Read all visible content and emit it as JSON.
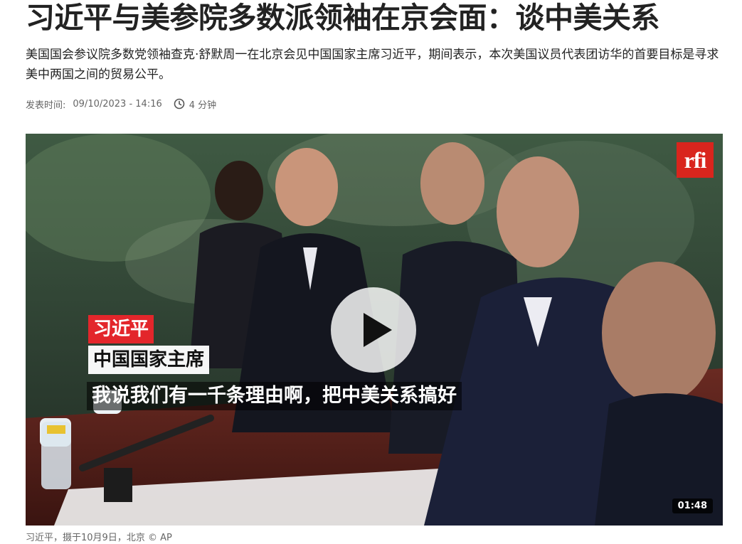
{
  "article": {
    "headline": "习近平与美参院多数派领袖在京会面：谈中美关系",
    "lede": "美国国会参议院多数党领袖查克·舒默周一在北京会见中国国家主席习近平，期间表示，本次美国议员代表团访华的首要目标是寻求美中两国之间的贸易公平。",
    "meta": {
      "published_label": "发表时间:",
      "published_datetime": "09/10/2023 - 14:16",
      "read_time": "4 分钟",
      "clock_icon": "clock-icon"
    }
  },
  "video": {
    "logo": "rfi",
    "subtitle_name": "习近平",
    "subtitle_title": "中国国家主席",
    "subtitle_quote": "我说我们有一千条理由啊，把中美关系搞好",
    "duration": "01:48",
    "play_icon": "play-icon"
  },
  "figure": {
    "caption": "习近平，摄于10月9日，北京 © AP"
  },
  "colors": {
    "logo_red": "#d9251d",
    "name_tag_red": "#e3262b",
    "text_gray": "#666666"
  }
}
